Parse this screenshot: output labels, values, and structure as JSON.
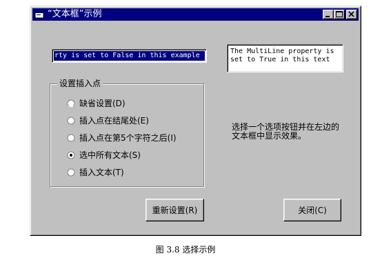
{
  "window": {
    "title": "“文本框”示例",
    "controls": {
      "minimize_icon": "minimize-icon",
      "maximize_icon": "maximize-icon",
      "close_icon": "close-icon"
    }
  },
  "textboxes": {
    "single_line_text": "rty is set to False in this example",
    "multi_line_text": "The MultiLine property is set to True in this text"
  },
  "options_group": {
    "legend": "设置插入点",
    "options": [
      {
        "label": "缺省设置(D)",
        "selected": false
      },
      {
        "label": "插入点在结尾处(E)",
        "selected": false
      },
      {
        "label": "插入点在第5个字符之后(I)",
        "selected": false
      },
      {
        "label": "选中所有文本(S)",
        "selected": true
      },
      {
        "label": "插入文本(T)",
        "selected": false
      }
    ]
  },
  "info_text": "选择一个选项按钮并在左边的文本框中显示效果。",
  "buttons": {
    "reset_label": "重新设置(R)",
    "close_label": "关闭(C)"
  },
  "caption": "图 3.8   选择示例",
  "colors": {
    "face": "#c0c0c0",
    "titlebar": "#000080",
    "selection": "#000080"
  }
}
